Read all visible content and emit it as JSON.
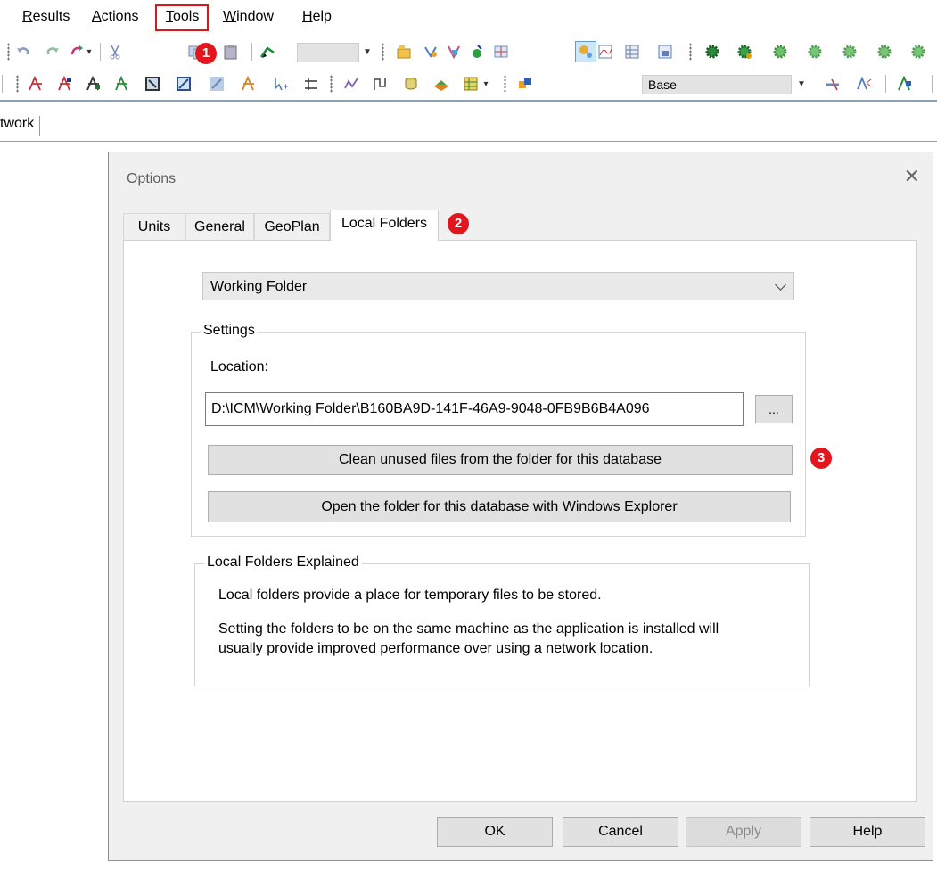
{
  "menu": {
    "items": [
      {
        "label": "Results",
        "accel": "R",
        "rest": "esults"
      },
      {
        "label": "Actions",
        "accel": "A",
        "rest": "ctions"
      },
      {
        "label": "Tools",
        "accel": "T",
        "rest": "ools"
      },
      {
        "label": "Window",
        "accel": "W",
        "rest": "indow"
      },
      {
        "label": "Help",
        "accel": "H",
        "rest": "elp"
      }
    ]
  },
  "toolbar": {
    "scenario_combo": "Base"
  },
  "doc_tab": {
    "label": "twork"
  },
  "dialog": {
    "title": "Options",
    "close": "✕",
    "tabs": [
      "Units",
      "General",
      "GeoPlan",
      "Local Folders"
    ],
    "folder_type": "Working Folder",
    "settings": {
      "legend": "Settings",
      "location_label": "Location:",
      "location_value": "D:\\ICM\\Working Folder\\B160BA9D-141F-46A9-9048-0FB9B6B4A096",
      "browse_label": "...",
      "clean_label": "Clean unused files from the folder for this database",
      "open_label": "Open the folder for this database with Windows Explorer"
    },
    "explained": {
      "legend": "Local Folders Explained",
      "line1": "Local folders provide a place for temporary files to be stored.",
      "line2": "Setting the folders to be on the same machine as the application is installed will",
      "line3": "usually provide improved performance over using a network location."
    },
    "buttons": {
      "ok": "OK",
      "cancel": "Cancel",
      "apply": "Apply",
      "help": "Help"
    }
  },
  "badges": [
    "1",
    "2",
    "3"
  ],
  "colors": {
    "badge": "#e3161d",
    "highlight": "#d9161b"
  }
}
